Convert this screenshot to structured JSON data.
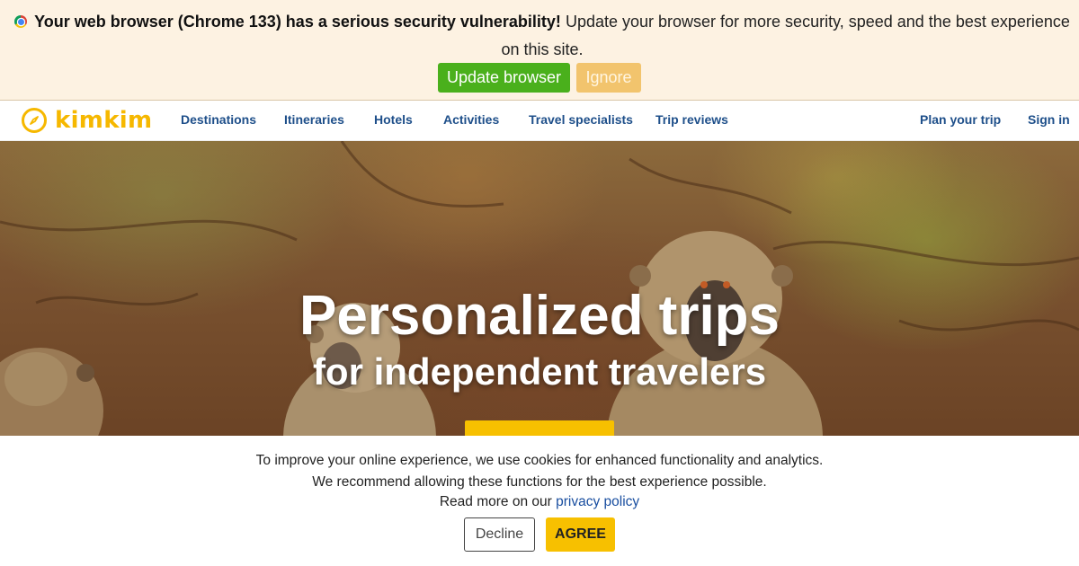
{
  "banner": {
    "icon": "chrome-icon",
    "warning_bold": "Your web browser (Chrome 133) has a serious security vulnerability!",
    "warning_rest": "Update your browser for more security, speed and the best experience on this site.",
    "update_label": "Update browser",
    "ignore_label": "Ignore",
    "colors": {
      "background": "#fdf2e2",
      "update": "#4ab01c",
      "ignore": "#f2c46d"
    }
  },
  "nav": {
    "logo_text": "kimkim",
    "logo_icon": "compass-icon",
    "links": [
      "Destinations",
      "Itineraries",
      "Hotels",
      "Activities",
      "Travel specialists",
      "Trip reviews"
    ],
    "plan_label": "Plan your trip",
    "signin_label": "Sign in",
    "colors": {
      "logo": "#f6b800",
      "link": "#1e4f8a"
    }
  },
  "hero": {
    "title": "Personalized trips",
    "subtitle": "for independent travelers",
    "cta_color": "#f7c000"
  },
  "cookie": {
    "line1": "To improve your online experience, we use cookies for enhanced functionality and analytics.",
    "line2": "We recommend allowing these functions for the best experience possible.",
    "line3_prefix": "Read more on our",
    "privacy_link": "privacy policy",
    "decline_label": "Decline",
    "agree_label": "AGREE",
    "colors": {
      "agree": "#f7c000",
      "link": "#1a4fa0"
    }
  }
}
